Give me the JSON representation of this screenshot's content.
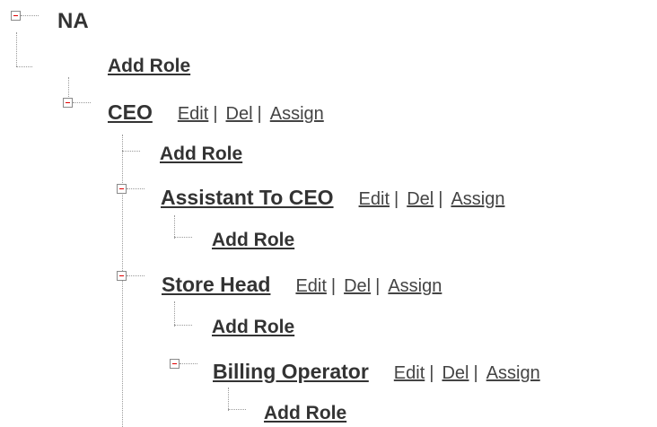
{
  "tree": {
    "root": {
      "label": "NA"
    },
    "add_role_label": "Add Role",
    "actions": {
      "edit": "Edit",
      "del": "Del",
      "assign": "Assign",
      "separator": "|"
    },
    "roles": {
      "ceo": {
        "label": "CEO"
      },
      "assistant_to_ceo": {
        "label": "Assistant To CEO"
      },
      "store_head": {
        "label": "Store Head"
      },
      "billing_operator": {
        "label": "Billing Operator"
      }
    }
  },
  "colors": {
    "text": "#333333",
    "toggle_minus": "#e00000",
    "toggle_border": "#8a8a8a",
    "guide_line": "#9a9a9a"
  },
  "icons": {
    "toggle": "collapse-minus-icon"
  }
}
